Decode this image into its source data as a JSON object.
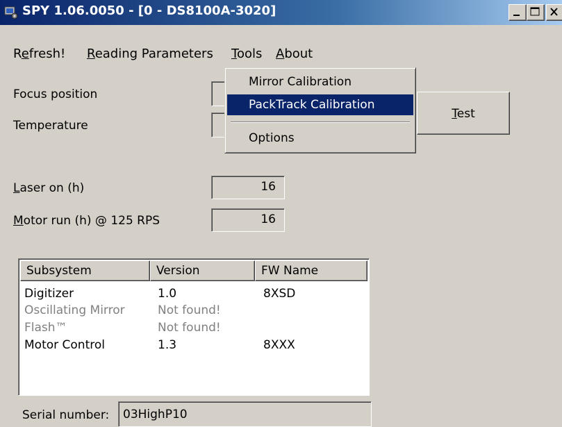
{
  "window": {
    "title": "SPY 1.06.0050 - [0 - DS8100A-3020]",
    "icon": "spy-app-icon",
    "controls": [
      "minimize-icon",
      "maximize-icon",
      "close-icon"
    ]
  },
  "menubar": {
    "items": [
      {
        "label": "Refresh!",
        "mnemonic_index": 1
      },
      {
        "label": "Reading Parameters",
        "mnemonic_index": 0
      },
      {
        "label": "Tools",
        "mnemonic_index": 0
      },
      {
        "label": "About",
        "mnemonic_index": 0
      }
    ]
  },
  "tools_menu": {
    "items": [
      {
        "label": "Mirror Calibration",
        "highlighted": false
      },
      {
        "label": "PackTrack Calibration",
        "highlighted": true
      },
      {
        "label": "Options",
        "highlighted": false
      }
    ]
  },
  "fields": {
    "focus_position_label": "Focus position",
    "temperature_label": "Temperature",
    "laser_on_label": "Laser on (h)",
    "laser_on_value": "16",
    "motor_run_label": "Motor run (h) @ 125 RPS",
    "motor_run_value": "16"
  },
  "test_button": {
    "label": "Test"
  },
  "subsystems": {
    "columns": [
      "Subsystem",
      "Version",
      "FW Name"
    ],
    "rows": [
      {
        "subsystem": "Digitizer",
        "version": "1.0",
        "fw_name": "8XSD",
        "found": true
      },
      {
        "subsystem": "Oscillating Mirror",
        "version": "Not found!",
        "fw_name": "",
        "found": false
      },
      {
        "subsystem": "Flash™",
        "version": "Not found!",
        "fw_name": "",
        "found": false
      },
      {
        "subsystem": "Motor Control",
        "version": "1.3",
        "fw_name": "8XXX",
        "found": true
      }
    ]
  },
  "serial": {
    "label": "Serial number:",
    "value": "03HighP10"
  },
  "colors": {
    "titlebar_start": "#0a246a",
    "titlebar_end": "#a6caf0",
    "window_bg": "#d4d0c8",
    "selection": "#0a246a",
    "disabled_text": "#808080"
  }
}
